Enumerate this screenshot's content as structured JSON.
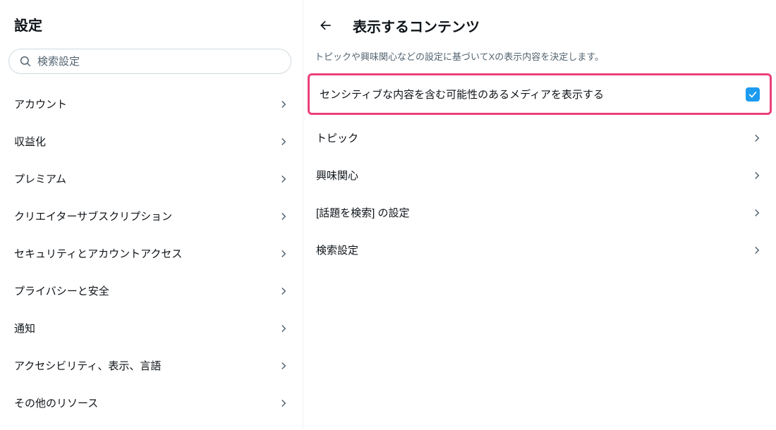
{
  "sidebar": {
    "title": "設定",
    "search_placeholder": "検索設定",
    "items": [
      {
        "label": "アカウント"
      },
      {
        "label": "収益化"
      },
      {
        "label": "プレミアム"
      },
      {
        "label": "クリエイターサブスクリプション"
      },
      {
        "label": "セキュリティとアカウントアクセス"
      },
      {
        "label": "プライバシーと安全"
      },
      {
        "label": "通知"
      },
      {
        "label": "アクセシビリティ、表示、言語"
      },
      {
        "label": "その他のリソース"
      }
    ]
  },
  "main": {
    "title": "表示するコンテンツ",
    "description": "トピックや興味関心などの設定に基づいてXの表示内容を決定します。",
    "sensitive_label": "センシティブな内容を含む可能性のあるメディアを表示する",
    "sensitive_checked": true,
    "items": [
      {
        "label": "トピック"
      },
      {
        "label": "興味関心"
      },
      {
        "label": "[話題を検索] の設定"
      },
      {
        "label": "検索設定"
      }
    ]
  },
  "colors": {
    "accent": "#1d9bf0",
    "highlight_border": "#ec407a"
  }
}
